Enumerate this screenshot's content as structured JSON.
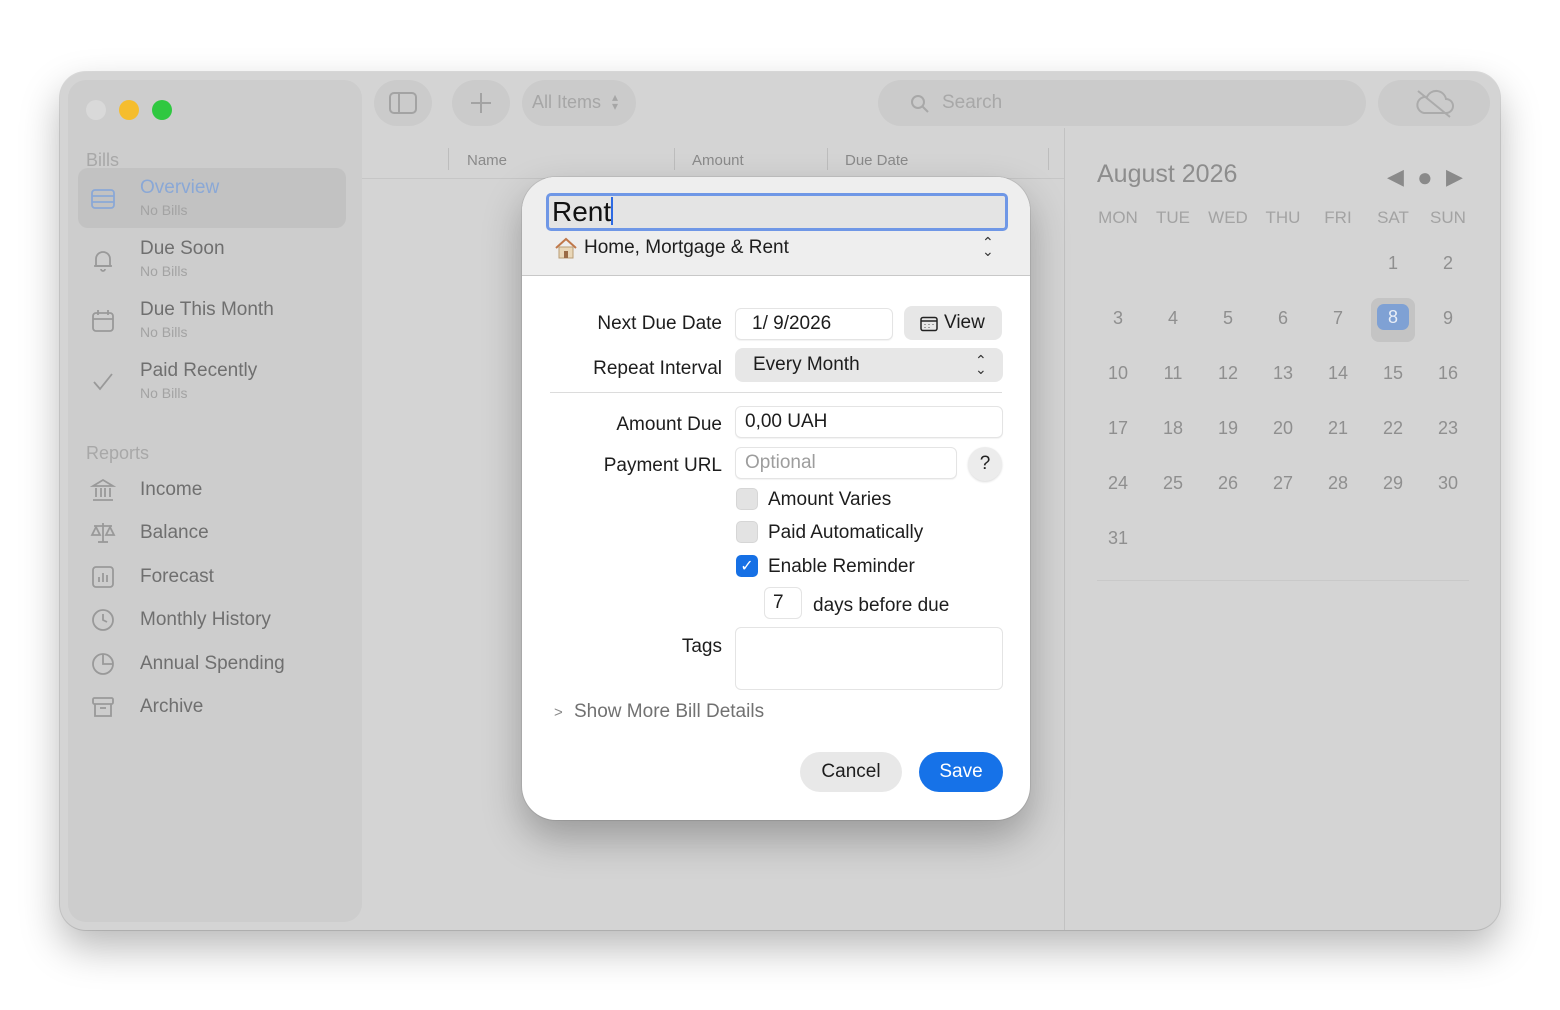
{
  "sidebar": {
    "bills_title": "Bills",
    "items": [
      {
        "label": "Overview",
        "sub": "No Bills"
      },
      {
        "label": "Due Soon",
        "sub": "No Bills"
      },
      {
        "label": "Due This Month",
        "sub": "No Bills"
      },
      {
        "label": "Paid Recently",
        "sub": "No Bills"
      }
    ],
    "reports_title": "Reports",
    "reports": [
      {
        "label": "Income"
      },
      {
        "label": "Balance"
      },
      {
        "label": "Forecast"
      },
      {
        "label": "Monthly History"
      },
      {
        "label": "Annual Spending"
      },
      {
        "label": "Archive"
      }
    ]
  },
  "toolbar": {
    "filter_label": "All Items",
    "search_placeholder": "Search"
  },
  "table": {
    "columns": [
      "Name",
      "Amount",
      "Due Date"
    ]
  },
  "calendar": {
    "month_title": "August 2026",
    "weekdays": [
      "MON",
      "TUE",
      "WED",
      "THU",
      "FRI",
      "SAT",
      "SUN"
    ],
    "first_weekday_index": 5,
    "days_in_month": 31,
    "today": 8
  },
  "dialog": {
    "name_value": "Rent",
    "category": "Home, Mortgage & Rent",
    "next_due_label": "Next Due Date",
    "next_due_value": "1/  9/2026",
    "view_label": "View",
    "repeat_label": "Repeat Interval",
    "repeat_value": "Every Month",
    "amount_label": "Amount Due",
    "amount_value": "0,00 UAH",
    "url_label": "Payment URL",
    "url_placeholder": "Optional",
    "help_label": "?",
    "amount_varies_label": "Amount Varies",
    "amount_varies_checked": false,
    "paid_auto_label": "Paid Automatically",
    "paid_auto_checked": false,
    "reminder_label": "Enable Reminder",
    "reminder_checked": true,
    "reminder_days": "7",
    "reminder_days_label": "days before due",
    "tags_label": "Tags",
    "show_more_label": "Show More Bill Details",
    "cancel_label": "Cancel",
    "save_label": "Save"
  },
  "colors": {
    "accent": "#1672e8",
    "selection_blue": "#7fa1d4",
    "traffic_close": "#d9d9d9",
    "traffic_min": "#f5bd2e",
    "traffic_max": "#2fc840"
  }
}
